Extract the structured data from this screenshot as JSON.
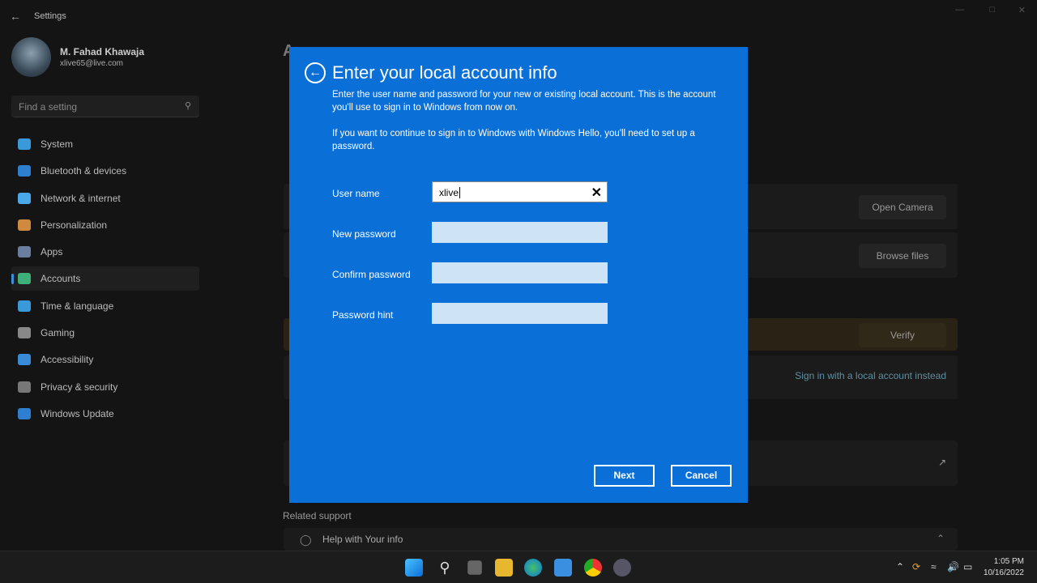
{
  "window": {
    "title": "Settings"
  },
  "profile": {
    "name": "M. Fahad Khawaja",
    "email": "xlive65@live.com"
  },
  "search": {
    "placeholder": "Find a setting"
  },
  "nav": [
    {
      "label": "System",
      "color": "#3a9ad9"
    },
    {
      "label": "Bluetooth & devices",
      "color": "#2f7fd0"
    },
    {
      "label": "Network & internet",
      "color": "#4aa8e8"
    },
    {
      "label": "Personalization",
      "color": "#d08a40"
    },
    {
      "label": "Apps",
      "color": "#6a7fa0"
    },
    {
      "label": "Accounts",
      "color": "#3fb07a",
      "active": true
    },
    {
      "label": "Time & language",
      "color": "#3a9ad9"
    },
    {
      "label": "Gaming",
      "color": "#888"
    },
    {
      "label": "Accessibility",
      "color": "#3a8ad8"
    },
    {
      "label": "Privacy & security",
      "color": "#777"
    },
    {
      "label": "Windows Update",
      "color": "#2f7fd0"
    }
  ],
  "background": {
    "open_camera": "Open Camera",
    "browse_files": "Browse files",
    "verify": "Verify",
    "local_account_link": "Sign in with a local account instead",
    "related_support": "Related support",
    "help_item": "Help with Your info"
  },
  "dialog": {
    "title": "Enter your local account info",
    "intro": "Enter the user name and password for your new or existing local account. This is the account you'll use to sign in to Windows from now on.",
    "hello_note": "If you want to continue to sign in to Windows with Windows Hello, you'll need to set up a password.",
    "fields": {
      "username_label": "User name",
      "username_value": "xlive",
      "new_password_label": "New password",
      "confirm_password_label": "Confirm password",
      "hint_label": "Password hint"
    },
    "next": "Next",
    "cancel": "Cancel",
    "accent": "#0b6fd8"
  },
  "taskbar": {
    "time": "1:05 PM",
    "date": "10/16/2022"
  }
}
